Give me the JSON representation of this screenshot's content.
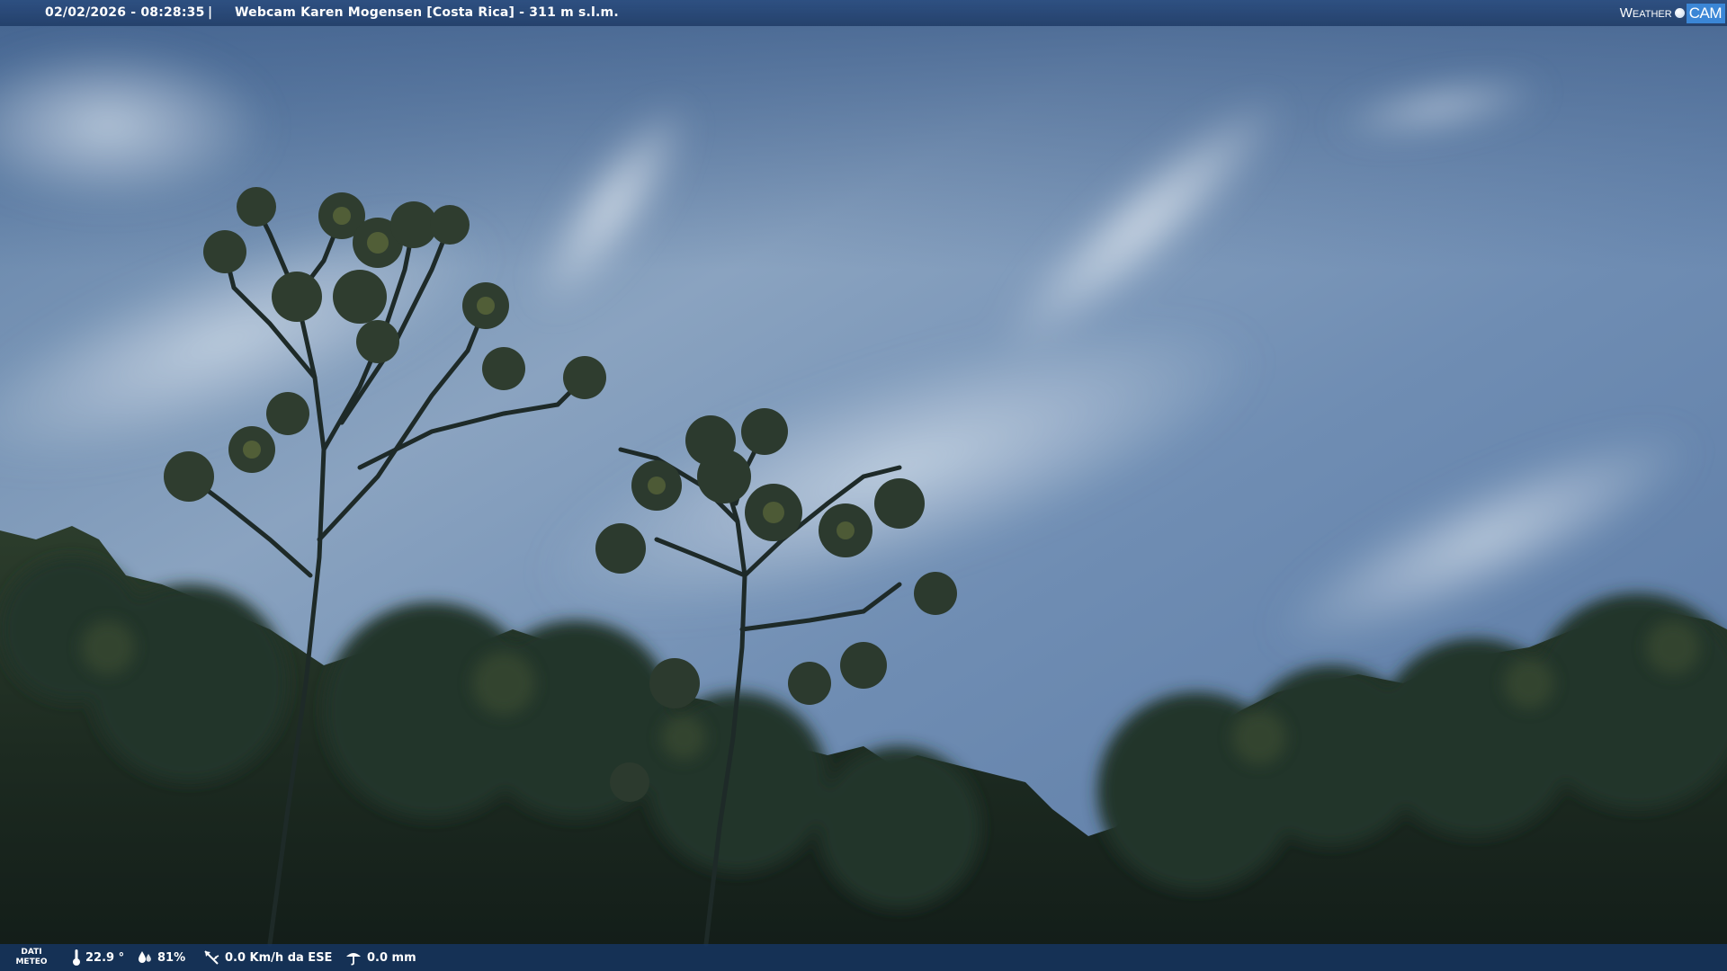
{
  "overlay": {
    "timestamp": "02/02/2026 - 08:28:35",
    "separator": "|",
    "title": "Webcam Karen Mogensen [Costa Rica]  - 311 m s.l.m.",
    "logo_weather": "Weather",
    "logo_cam": "CAM"
  },
  "meteo": {
    "label_line1": "DATI",
    "label_line2": "METEO",
    "temperature": "22.9 °",
    "humidity": "81%",
    "wind": "0.0 Km/h da ESE",
    "rain": "0.0 mm"
  },
  "icons": {
    "temperature": "thermometer-icon",
    "humidity": "humidity-drop-icon",
    "wind": "wind-vane-icon",
    "rain": "rain-gauge-icon"
  },
  "colors": {
    "sky_top": "#4c6a95",
    "sky_haze": "#9fb4cb",
    "foliage_dark": "#1a2a22",
    "bar_blue": "#1c3f6e",
    "logo_blue": "#3b86d6"
  }
}
